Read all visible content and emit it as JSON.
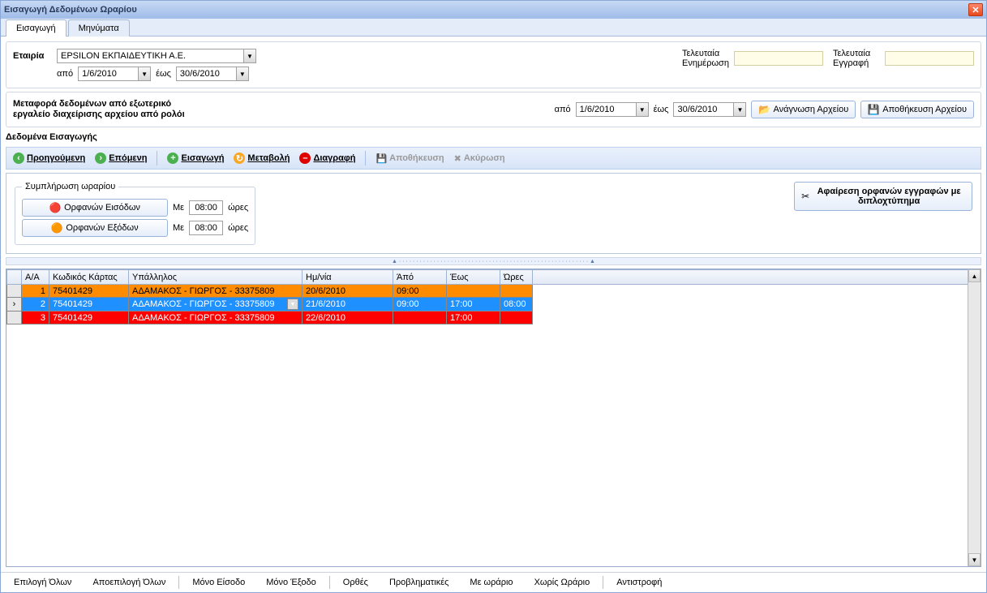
{
  "window": {
    "title": "Εισαγωγή Δεδομένων Ωραρίου"
  },
  "tabs": {
    "import": "Εισαγωγή",
    "messages": "Μηνύματα"
  },
  "company": {
    "label": "Εταιρία",
    "value": "EPSILON ΕΚΠΑΙΔΕΥΤΙΚΗ Α.Ε.",
    "from_label": "από",
    "from_value": "1/6/2010",
    "to_label": "έως",
    "to_value": "30/6/2010"
  },
  "last_update": {
    "label": "Τελευταία Ενημέρωση",
    "value": ""
  },
  "last_entry": {
    "label": "Τελευταία Εγγραφή",
    "value": ""
  },
  "import": {
    "text1": "Μεταφορά δεδομένων από εξωτερικό",
    "text2": "εργαλείο διαχείρισης αρχείου από ρολόι",
    "from_label": "από",
    "from_value": "1/6/2010",
    "to_label": "έως",
    "to_value": "30/6/2010",
    "read_btn": "Ανάγνωση Αρχείου",
    "save_btn": "Αποθήκευση Αρχείου"
  },
  "section_title": "Δεδομένα Εισαγωγής",
  "toolbar": {
    "prev": "Προηγούμενη",
    "next": "Επόμενη",
    "insert": "Εισαγωγή",
    "modify": "Μεταβολή",
    "delete": "Διαγραφή",
    "save": "Αποθήκευση",
    "cancel": "Ακύρωση"
  },
  "fill": {
    "legend": "Συμπλήρωση ωραρίου",
    "in_btn": "Ορφανών Εισόδων",
    "out_btn": "Ορφανών Εξόδων",
    "with": "Με",
    "time1": "08:00",
    "time2": "08:00",
    "hours": "ώρες"
  },
  "remove_orphans": "Αφαίρεση ορφανών εγγραφών με διπλοχτύπημα",
  "grid": {
    "headers": {
      "aa": "Α/Α",
      "card": "Κωδικός Κάρτας",
      "emp": "Υπάλληλος",
      "date": "Ημ/νία",
      "from": "Άπό",
      "to": "Έως",
      "hrs": "Ώρες"
    },
    "rows": [
      {
        "aa": "1",
        "card": "75401429",
        "emp": "ΑΔΑΜΑΚΟΣ - ΓΙΩΡΓΟΣ - 33375809",
        "date": "20/6/2010",
        "from": "09:00",
        "to": "",
        "hrs": "",
        "color": "orange",
        "ptr": ""
      },
      {
        "aa": "2",
        "card": "75401429",
        "emp": "ΑΔΑΜΑΚΟΣ - ΓΙΩΡΓΟΣ - 33375809",
        "date": "21/6/2010",
        "from": "09:00",
        "to": "17:00",
        "hrs": "08:00",
        "color": "blue",
        "ptr": "›"
      },
      {
        "aa": "3",
        "card": "75401429",
        "emp": "ΑΔΑΜΑΚΟΣ - ΓΙΩΡΓΟΣ - 33375809",
        "date": "22/6/2010",
        "from": "",
        "to": "17:00",
        "hrs": "",
        "color": "red",
        "ptr": ""
      }
    ]
  },
  "bottom": {
    "select_all": "Επιλογή Όλων",
    "deselect_all": "Αποεπιλογή Όλων",
    "only_in": "Μόνο Είσοδο",
    "only_out": "Μόνο Έξοδο",
    "correct": "Ορθές",
    "problematic": "Προβληματικές",
    "with_schedule": "Με ωράριο",
    "without_schedule": "Χωρίς Ωράριο",
    "reverse": "Αντιστροφή"
  }
}
